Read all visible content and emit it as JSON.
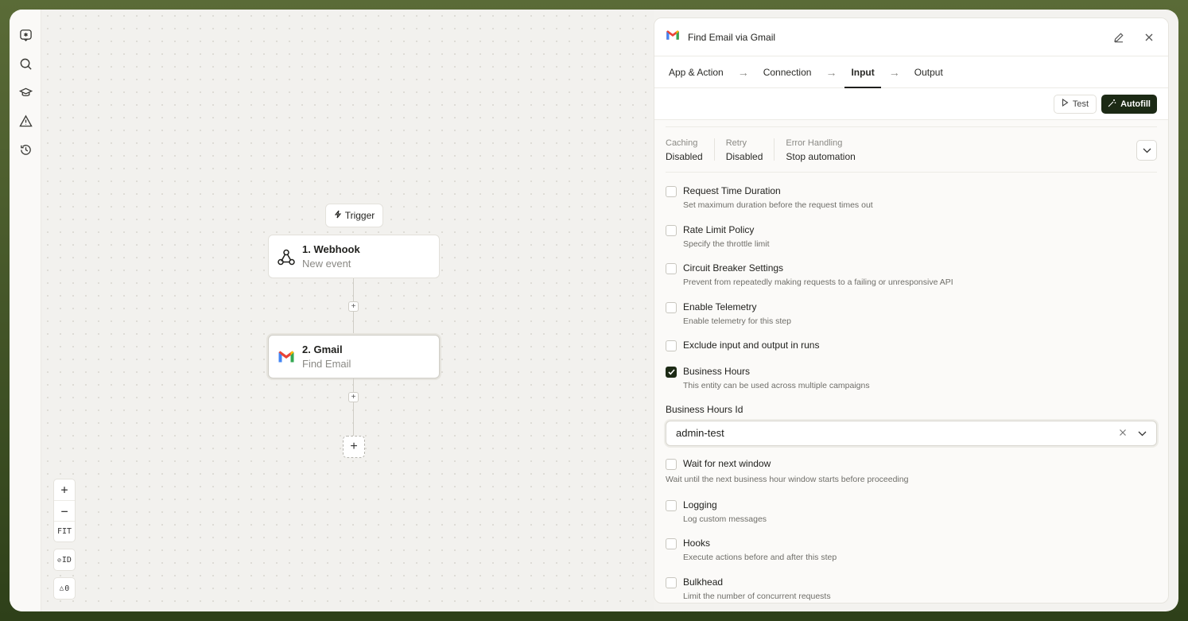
{
  "canvas": {
    "trigger_label": "Trigger",
    "nodes": [
      {
        "title": "1. Webhook",
        "subtitle": "New event"
      },
      {
        "title": "2. Gmail",
        "subtitle": "Find Email"
      }
    ],
    "controls": {
      "fit": "FIT",
      "id": "ID",
      "warnings": "0"
    }
  },
  "panel": {
    "title": "Find Email via Gmail",
    "steps": [
      "App & Action",
      "Connection",
      "Input",
      "Output"
    ],
    "active_step": "Input",
    "toolbar": {
      "test": "Test",
      "autofill": "Autofill"
    },
    "summary": [
      {
        "label": "Caching",
        "value": "Disabled"
      },
      {
        "label": "Retry",
        "value": "Disabled"
      },
      {
        "label": "Error Handling",
        "value": "Stop automation"
      }
    ],
    "options_top": [
      {
        "label": "Request Time Duration",
        "desc": "Set maximum duration before the request times out",
        "checked": false
      },
      {
        "label": "Rate Limit Policy",
        "desc": "Specify the throttle limit",
        "checked": false
      },
      {
        "label": "Circuit Breaker Settings",
        "desc": "Prevent from repeatedly making requests to a failing or unresponsive API",
        "checked": false
      },
      {
        "label": "Enable Telemetry",
        "desc": "Enable telemetry for this step",
        "checked": false
      },
      {
        "label": "Exclude input and output in runs",
        "desc": "",
        "checked": false
      },
      {
        "label": "Business Hours",
        "desc": "This entity can be used across multiple campaigns",
        "checked": true
      }
    ],
    "business_hours": {
      "field_label": "Business Hours Id",
      "value": "admin-test",
      "wait_label": "Wait for next window",
      "wait_desc": "Wait until the next business hour window starts before proceeding"
    },
    "options_bottom": [
      {
        "label": "Logging",
        "desc": "Log custom messages",
        "checked": false
      },
      {
        "label": "Hooks",
        "desc": "Execute actions before and after this step",
        "checked": false
      },
      {
        "label": "Bulkhead",
        "desc": "Limit the number of concurrent requests",
        "checked": false
      }
    ]
  },
  "colors": {
    "accent": "#1c2a15",
    "frame": "#3d5123"
  }
}
